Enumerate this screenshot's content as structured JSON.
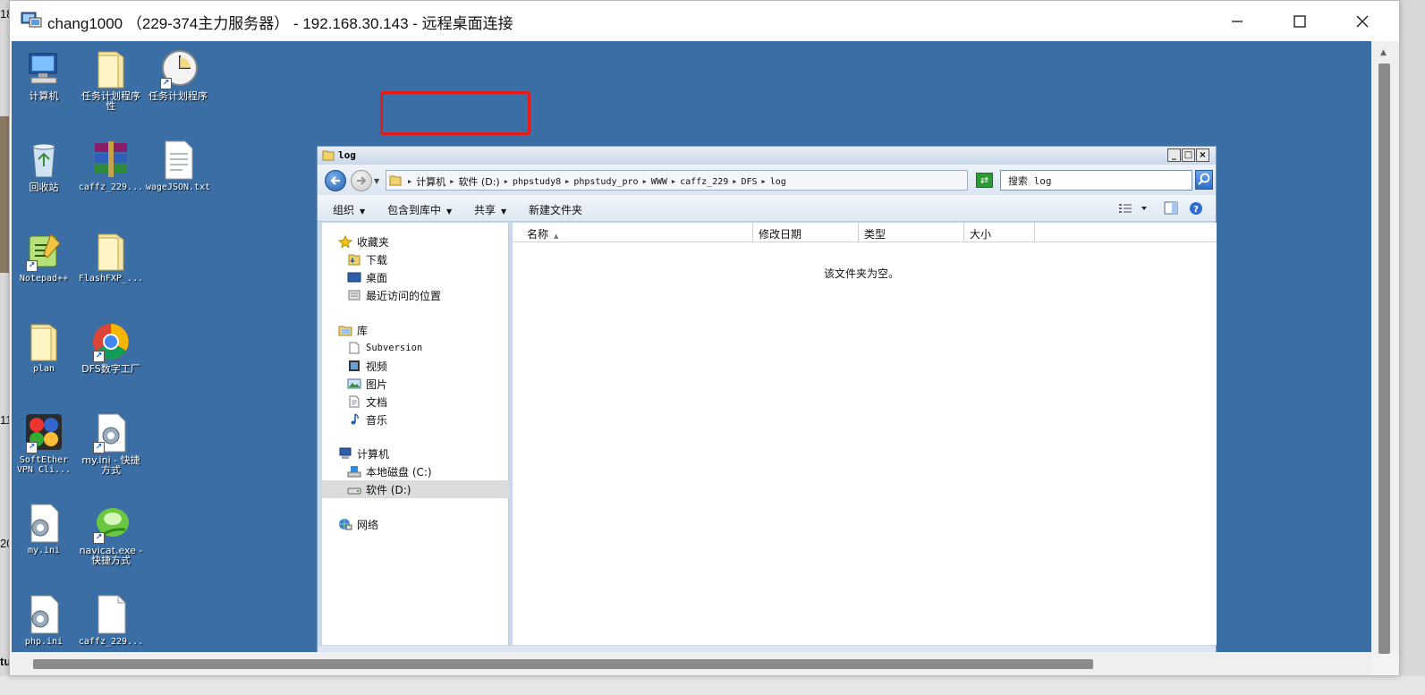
{
  "rdp_window": {
    "title": "chang1000 （229-374主力服务器） - 192.168.30.143 - 远程桌面连接",
    "minimize_label": "minimize",
    "maximize_label": "maximize",
    "close_label": "close"
  },
  "host_peek": {
    "left_chars": [
      "18",
      "11",
      "20",
      "tu"
    ],
    "right_chars": []
  },
  "desktop_icons": [
    {
      "label": "计算机",
      "icon": "computer-icon"
    },
    {
      "label": "任务计划程序性",
      "icon": "folder-icon"
    },
    {
      "label": "任务计划程序",
      "icon": "clock-shortcut-icon"
    },
    {
      "label": "回收站",
      "icon": "recycle-bin-icon"
    },
    {
      "label": "caffz_229...",
      "icon": "winrar-icon"
    },
    {
      "label": "wageJSON.txt",
      "icon": "text-file-icon"
    },
    {
      "label": "Notepad++",
      "icon": "notepadpp-icon"
    },
    {
      "label": "FlashFXP_...",
      "icon": "folder-icon"
    },
    {
      "label": "plan",
      "icon": "folder-icon"
    },
    {
      "label": "DFS数字工厂",
      "icon": "chrome-icon"
    },
    {
      "label": "SoftEther VPN Cli...",
      "icon": "softether-icon"
    },
    {
      "label": "my.ini - 快捷方式",
      "icon": "ini-shortcut-icon"
    },
    {
      "label": "my.ini",
      "icon": "ini-file-icon"
    },
    {
      "label": "navicat.exe - 快捷方式",
      "icon": "navicat-icon"
    },
    {
      "label": "php.ini",
      "icon": "ini-file-icon"
    },
    {
      "label": "caffz_229...",
      "icon": "blank-file-icon"
    }
  ],
  "explorer": {
    "title": "log",
    "breadcrumb": [
      "计算机",
      "软件 (D:)",
      "phpstudy8",
      "phpstudy_pro",
      "WWW",
      "caffz_229",
      "DFS",
      "log"
    ],
    "search_placeholder": "搜索 log",
    "toolbar": {
      "organize": "组织",
      "include_in_library": "包含到库中",
      "share": "共享",
      "new_folder": "新建文件夹"
    },
    "nav": {
      "favorites": "收藏夹",
      "favorites_items": [
        "下载",
        "桌面",
        "最近访问的位置"
      ],
      "libraries": "库",
      "library_items": [
        "Subversion",
        "视频",
        "图片",
        "文档",
        "音乐"
      ],
      "computer": "计算机",
      "computer_items": [
        "本地磁盘 (C:)",
        "软件 (D:)"
      ],
      "network": "网络"
    },
    "columns": [
      "名称",
      "修改日期",
      "类型",
      "大小"
    ],
    "empty_message": "该文件夹为空。"
  },
  "colors": {
    "desktop": "#3a6ea5",
    "highlight_box": "#e31b1b"
  }
}
